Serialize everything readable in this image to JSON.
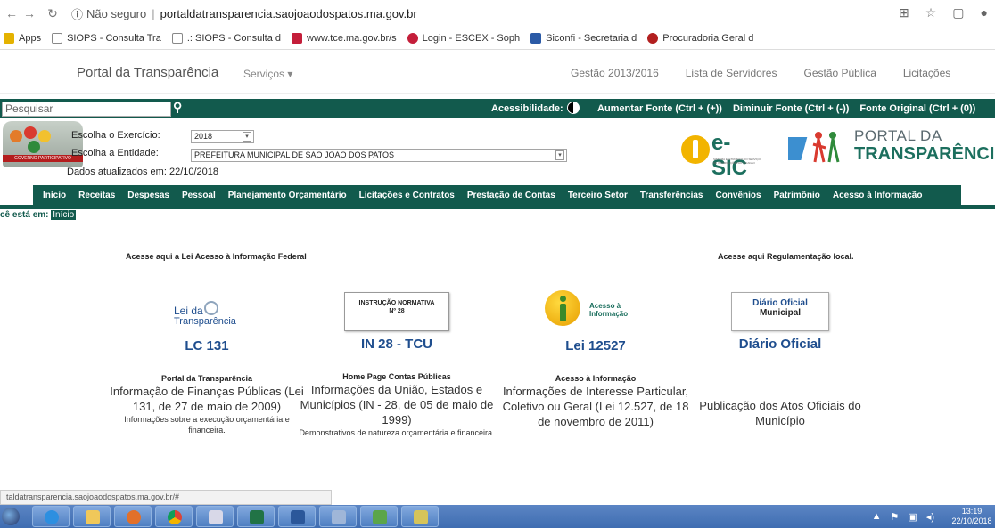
{
  "browser": {
    "back_icon": "back-arrow",
    "forward_icon": "forward-arrow",
    "reload_icon": "reload",
    "security_text": "Não seguro",
    "url": "portaldatransparencia.saojoaodospatos.ma.gov.br",
    "bookmarks": [
      {
        "label": "Apps",
        "color": "#e4b200"
      },
      {
        "label": "SIOPS - Consulta Tra",
        "color": "#888888"
      },
      {
        "label": ".: SIOPS - Consulta d",
        "color": "#888888"
      },
      {
        "label": "www.tce.ma.gov.br/s",
        "color": "#c41e3a"
      },
      {
        "label": "Login - ESCEX - Soph",
        "color": "#c41e3a"
      },
      {
        "label": "Siconfi - Secretaria d",
        "color": "#2b5aa6"
      },
      {
        "label": "Procuradoria Geral d",
        "color": "#b21f1f"
      }
    ],
    "status_url": "taldatransparencia.saojoaodospatos.ma.gov.br/#"
  },
  "site_top": {
    "brand": "Portal da Transparência",
    "services": "Serviços",
    "links": [
      "Gestão 2013/2016",
      "Lista de Servidores",
      "Gestão Pública",
      "Licitações"
    ]
  },
  "toolbar": {
    "search_placeholder": "Pesquisar",
    "accessibility": "Acessibilidade:",
    "font_links": [
      "Aumentar Fonte (Ctrl + (+))",
      "Diminuir Fonte (Ctrl + (-))",
      "Fonte Original (Ctrl + (0))"
    ]
  },
  "header": {
    "exercise_label": "Escolha o Exercício:",
    "exercise_value": "2018",
    "entity_label": "Escolha a Entidade:",
    "entity_value": "PREFEITURA MUNICIPAL DE SAO JOAO DOS PATOS",
    "updated": "Dados atualizados em: 22/10/2018",
    "gov_band": "GOVERNO PARTICIPATIVO",
    "esic": "e-SIC",
    "esic_sub": "SISTEMA ELETRÔNICO DO SERVIÇO DE INFORMAÇÕES AO CIDADÃO",
    "portal_line1": "PORTAL DA",
    "portal_line2": "TRANSPARÊNCIA"
  },
  "menu": [
    "Início",
    "Receitas",
    "Despesas",
    "Pessoal",
    "Planejamento Orçamentário",
    "Licitações e Contratos",
    "Prestação de Contas",
    "Terceiro Setor",
    "Transferências",
    "Convênios",
    "Patrimônio",
    "Acesso à Informação"
  ],
  "breadcrumb": {
    "prefix": "cê está em:",
    "current": "Início"
  },
  "body": {
    "left_heading": "Acesse aqui a Lei Acesso à Informação Federal",
    "right_heading": "Acesse aqui Regulamentação local.",
    "cards": [
      {
        "logo_line1": "Lei da",
        "logo_line2": "Transparência",
        "code": "LC 131",
        "title": "Portal da Transparência",
        "desc": "Informação de Finanças Públicas (Lei 131, de 27 de maio de 2009)",
        "small": "Informações sobre a execução orçamentária e financeira."
      },
      {
        "logo_line1": "INSTRUÇÃO NORMATIVA",
        "logo_line2": "Nº 28",
        "code": "IN 28 - TCU",
        "title": "Home Page Contas Públicas",
        "desc": "Informações da União, Estados e Municípios (IN - 28, de 05 de maio de 1999)",
        "small": "Demonstrativos de natureza orçamentária e financeira."
      },
      {
        "logo_line1": "Acesso à",
        "logo_line2": "Informação",
        "code": "Lei 12527",
        "title": "Acesso à Informação",
        "desc": "Informações de Interesse Particular, Coletivo ou Geral (Lei 12.527, de 18 de novembro de 2011)",
        "small": ""
      },
      {
        "logo_line1": "Diário Oficial",
        "logo_line2": "Municipal",
        "code": "Diário Oficial",
        "title": "",
        "desc": "Publicação dos Atos Oficiais do Município",
        "small": ""
      }
    ]
  },
  "taskbar": {
    "time": "13:19",
    "date": "22/10/2018"
  }
}
